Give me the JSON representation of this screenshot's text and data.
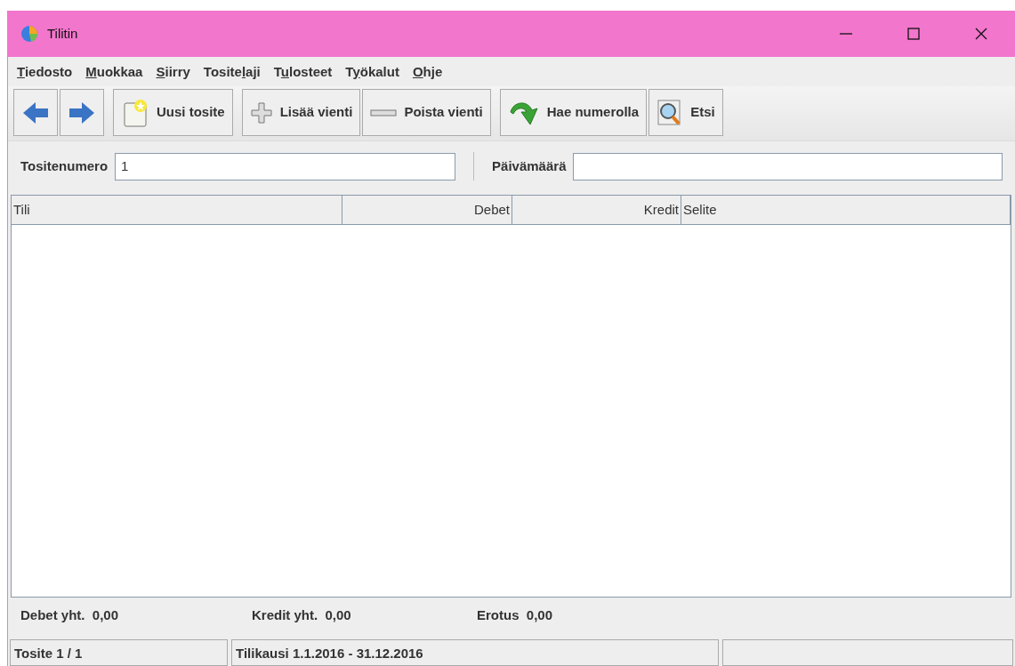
{
  "window": {
    "title": "Tilitin"
  },
  "menu": [
    {
      "key": "T",
      "post": "iedosto"
    },
    {
      "key": "M",
      "post": "uokkaa"
    },
    {
      "key": "S",
      "post": "iirry"
    },
    {
      "pre": "Tosite",
      "key": "l",
      "post": "aji"
    },
    {
      "pre": "T",
      "key": "u",
      "post": "losteet"
    },
    {
      "pre": "T",
      "key": "y",
      "post": "ökalut"
    },
    {
      "key": "O",
      "post": "hje"
    }
  ],
  "toolbar": [
    [
      {
        "kind": "back"
      },
      {
        "kind": "forward"
      }
    ],
    [
      {
        "kind": "new",
        "label": "Uusi tosite"
      }
    ],
    [
      {
        "kind": "add",
        "label": "Lisää vienti"
      },
      {
        "kind": "remove",
        "label": "Poista vienti"
      }
    ],
    [
      {
        "kind": "fetch",
        "label": "Hae numerolla"
      },
      {
        "kind": "search",
        "label": "Etsi"
      }
    ]
  ],
  "form": {
    "number_label": "Tositenumero",
    "number_value": "1",
    "date_label": "Päivämäärä"
  },
  "table": {
    "columns": [
      {
        "label": "Tili",
        "kind": "text"
      },
      {
        "label": "Debet",
        "kind": "amount"
      },
      {
        "label": "Kredit",
        "kind": "amount"
      },
      {
        "label": "Selite",
        "kind": "text"
      }
    ]
  },
  "totals": [
    {
      "label": "Debet yht.",
      "value": "0,00"
    },
    {
      "label": "Kredit yht.",
      "value": "0,00"
    },
    {
      "label": "Erotus",
      "value": "0,00"
    }
  ],
  "status_bar": [
    "Tosite 1 / 1",
    "Tilikausi 1.1.2016 - 31.12.2016"
  ]
}
